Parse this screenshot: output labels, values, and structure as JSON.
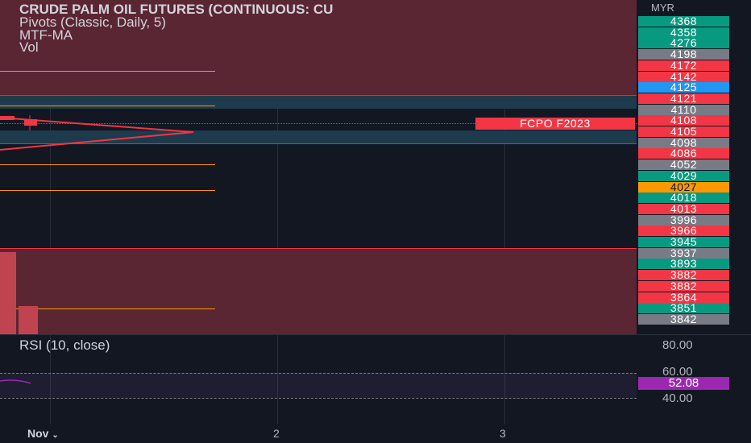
{
  "header": {
    "title": "CRUDE PALM OIL FUTURES (CONTINUOUS: CU",
    "indicators": [
      "Pivots (Classic, Daily, 5)",
      "MTF-MA",
      "Vol"
    ]
  },
  "symbol_label": "FCPO F2023",
  "currency": "MYR",
  "price_labels": [
    {
      "text": "4368",
      "color": "#089981"
    },
    {
      "text": "4358",
      "color": "#089981"
    },
    {
      "text": "4276",
      "color": "#089981"
    },
    {
      "text": "4198",
      "color": "#787b86"
    },
    {
      "text": "4172",
      "color": "#f23645"
    },
    {
      "text": "4142",
      "color": "#f23645"
    },
    {
      "text": "4125",
      "color": "#2196f3"
    },
    {
      "text": "4121",
      "color": "#f23645"
    },
    {
      "text": "4110",
      "color": "#787b86"
    },
    {
      "text": "4108",
      "color": "#f23645"
    },
    {
      "text": "4105",
      "color": "#f23645"
    },
    {
      "text": "4098",
      "color": "#787b86"
    },
    {
      "text": "4086",
      "color": "#f23645"
    },
    {
      "text": "4052",
      "color": "#787b86"
    },
    {
      "text": "4029",
      "color": "#089981"
    },
    {
      "text": "4027",
      "color": "#ff9800"
    },
    {
      "text": "4018",
      "color": "#089981"
    },
    {
      "text": "4013",
      "color": "#f23645"
    },
    {
      "text": "3996",
      "color": "#787b86"
    },
    {
      "text": "3966",
      "color": "#f23645"
    },
    {
      "text": "3945",
      "color": "#089981"
    },
    {
      "text": "3937",
      "color": "#787b86"
    },
    {
      "text": "3893",
      "color": "#089981"
    },
    {
      "text": "3882",
      "color": "#f23645"
    },
    {
      "text": "3882",
      "color": "#f23645"
    },
    {
      "text": "3864",
      "color": "#f23645"
    },
    {
      "text": "3851",
      "color": "#089981"
    },
    {
      "text": "3842",
      "color": "#787b86"
    }
  ],
  "rsi": {
    "title": "RSI (10, close)",
    "ticks": [
      "80.00",
      "60.00",
      "40.00"
    ],
    "value": "52.08",
    "value_color": "#9c27b0"
  },
  "time_axis": [
    "Nov",
    "2",
    "3"
  ],
  "colors": {
    "background": "#131722",
    "red_zone": "#5b2633",
    "blue_zone": "#1e3a4d",
    "pivot_line": "#ff9800",
    "candle": "#f23645"
  }
}
